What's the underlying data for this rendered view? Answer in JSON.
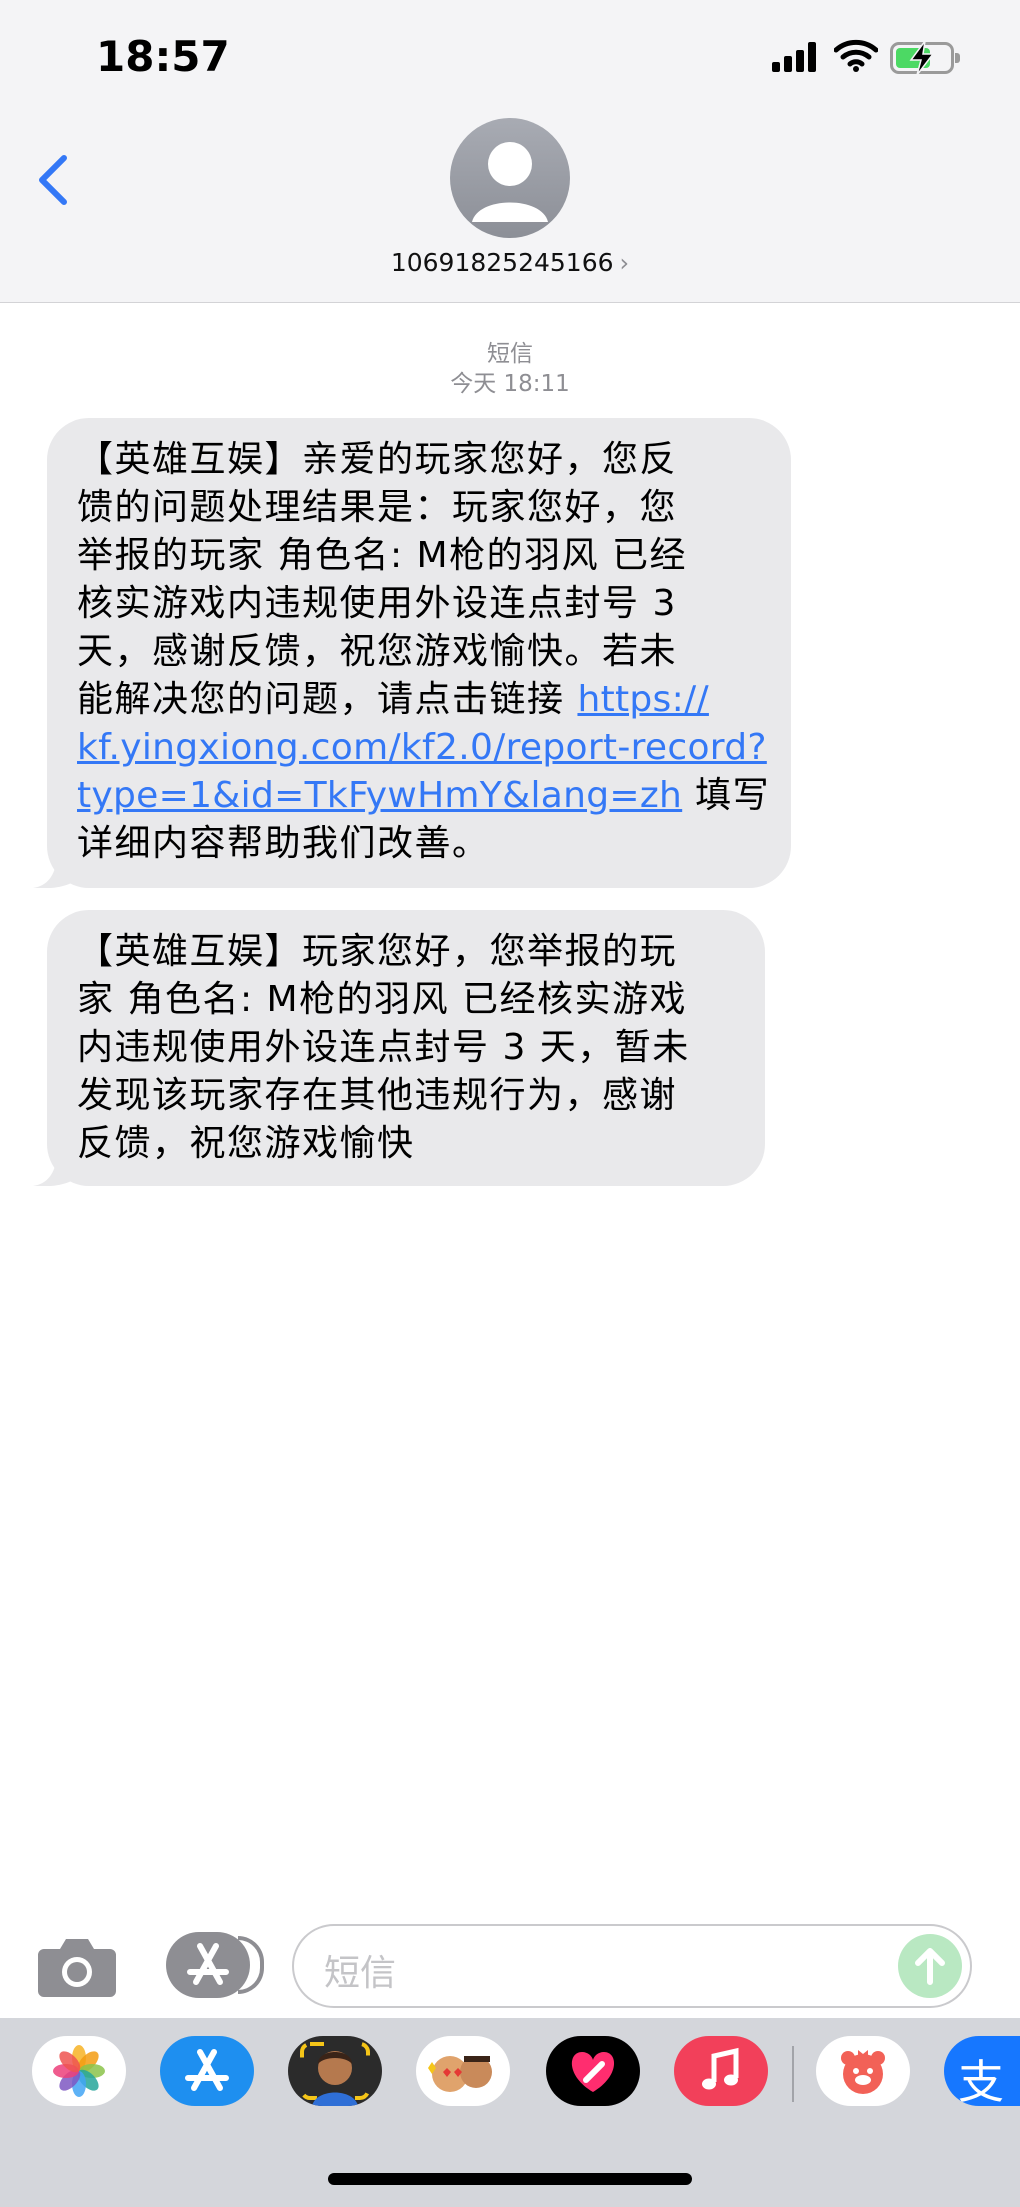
{
  "status_bar": {
    "time": "18:57",
    "battery": {
      "charging": true,
      "level_percent": 60
    }
  },
  "header": {
    "contact": "10691825245166",
    "contact_chevron": "›",
    "icons": [
      "back-chevron-icon",
      "contact-avatar-icon"
    ]
  },
  "conversation": {
    "service_label": "短信",
    "timestamp": "今天 18:11",
    "messages": [
      {
        "lines": [
          "【英雄互娱】亲爱的玩家您好，您反",
          "馈的问题处理结果是：玩家您好，您",
          "举报的玩家 角色名: M枪的羽风 已经",
          "核实游戏内违规使用外设连点封号 3",
          "天，感谢反馈，祝您游戏愉快。若未"
        ],
        "link_lead": "能解决您的问题，请点击链接 ",
        "link_line1": "https://",
        "link_line2": "kf.yingxiong.com/kf2.0/report-record?",
        "link_line3": "type=1&id=TkFywHmY&lang=zh",
        "after_link": " 填写",
        "last_line": "详细内容帮助我们改善。"
      },
      {
        "lines": [
          "【英雄互娱】玩家您好，您举报的玩",
          "家 角色名: M枪的羽风 已经核实游戏",
          "内违规使用外设连点封号 3 天，暂未",
          "发现该玩家存在其他违规行为，感谢",
          "反馈，祝您游戏愉快"
        ]
      }
    ]
  },
  "input_bar": {
    "placeholder": "短信",
    "icons": [
      "camera-icon",
      "app-store-icon",
      "send-arrow-icon"
    ]
  },
  "app_tray": {
    "apps": [
      "photos",
      "app-store",
      "memoji-camera",
      "memoji-stickers",
      "digital-touch",
      "music",
      "bear-app",
      "alipay"
    ],
    "alipay_glyph": "支"
  },
  "colors": {
    "link": "#3478f6",
    "bubble": "#e9e9eb",
    "tray": "#d4d6db"
  }
}
